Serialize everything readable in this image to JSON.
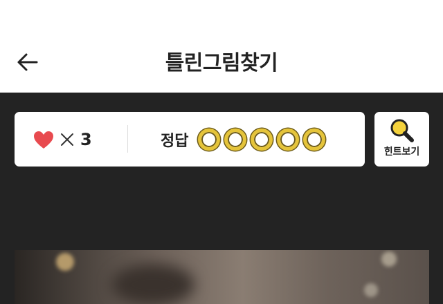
{
  "header": {
    "title": "틀린그림찾기",
    "back_icon": "arrow-left-icon"
  },
  "status": {
    "lives_icon": "heart-icon",
    "lives_multiplier": "×",
    "lives_count": "3",
    "answer_label": "정답",
    "answer_slots_found": 0,
    "answer_slots_total": 5
  },
  "hint": {
    "label": "힌트보기",
    "icon": "magnifier-icon"
  },
  "colors": {
    "background": "#232323",
    "heart": "#e84a4f",
    "slot_ring": "#e5c43a"
  }
}
